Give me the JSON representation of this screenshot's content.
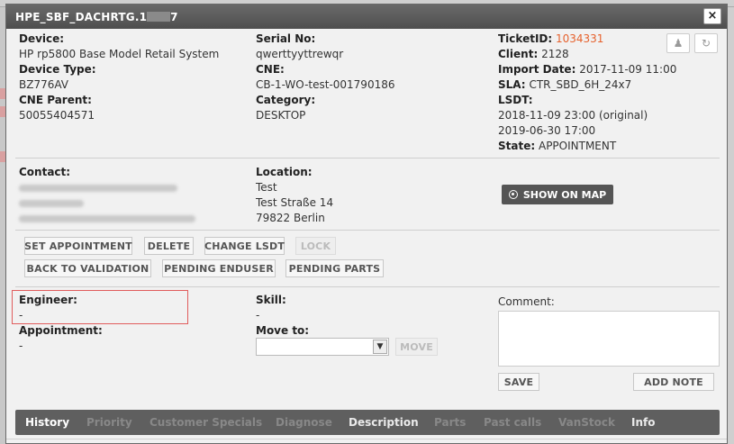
{
  "dialog": {
    "title": "HPE_SBF_DACHRTG.1",
    "title_suffix": "7",
    "close_label": "×"
  },
  "device": {
    "device_label": "Device:",
    "device_value": "HP rp5800 Base Model Retail System",
    "device_type_label": "Device Type:",
    "device_type_value": "BZ776AV",
    "cne_parent_label": "CNE Parent:",
    "cne_parent_value": "50055404571",
    "serial_label": "Serial No:",
    "serial_value": "qwerttyyttrewqr",
    "cne_label": "CNE:",
    "cne_value": "CB-1-WO-test-001790186",
    "category_label": "Category:",
    "category_value": "DESKTOP",
    "ticket_label": "TicketID:",
    "ticket_value": "1034331",
    "client_label": "Client:",
    "client_value": "2128",
    "import_label": "Import Date:",
    "import_value": "2017-11-09 11:00",
    "sla_label": "SLA:",
    "sla_value": "CTR_SBD_6H_24x7",
    "lsdt_label": "LSDT:",
    "lsdt_value_1": "2018-11-09 23:00 (original)",
    "lsdt_value_2": "2019-06-30 17:00",
    "state_label": "State:",
    "state_value": "APPOINTMENT"
  },
  "contact": {
    "contact_label": "Contact:",
    "location_label": "Location:",
    "location_line1": "Test",
    "location_line2": "Test Straße 14",
    "location_line3": "79822 Berlin",
    "map_button": "SHOW ON MAP"
  },
  "actions": {
    "set_appointment": "SET APPOINTMENT",
    "delete": "DELETE",
    "change_lsdt": "CHANGE LSDT",
    "lock": "LOCK",
    "back_to_validation": "BACK TO VALIDATION",
    "pending_enduser": "PENDING ENDUSER",
    "pending_parts": "PENDING PARTS"
  },
  "assignment": {
    "engineer_label": "Engineer:",
    "engineer_value": "-",
    "appointment_label": "Appointment:",
    "appointment_value": "-",
    "skill_label": "Skill:",
    "skill_value": "-",
    "move_to_label": "Move to:",
    "move_button": "MOVE",
    "comment_label": "Comment:",
    "save_button": "SAVE",
    "add_note_button": "ADD NOTE"
  },
  "tabs": [
    {
      "label": "History"
    },
    {
      "label": "Priority"
    },
    {
      "label": "Customer Specials"
    },
    {
      "label": "Diagnose"
    },
    {
      "label": "Description"
    },
    {
      "label": "Parts"
    },
    {
      "label": "Past calls"
    },
    {
      "label": "VanStock"
    },
    {
      "label": "Info"
    }
  ],
  "colors": {
    "accent": "#e6622e",
    "titlebar": "#555555",
    "highlight": "#e05c5c"
  }
}
